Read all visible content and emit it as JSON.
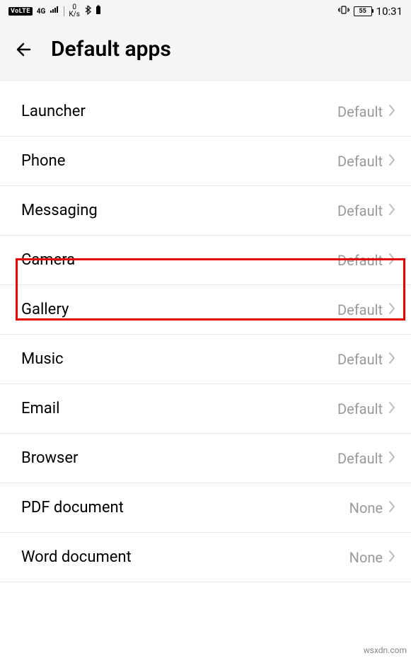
{
  "status_bar": {
    "volte": "VoLTE",
    "network": "4G",
    "speed_top": "0",
    "speed_bottom": "K/s",
    "battery": "55",
    "time": "10:31"
  },
  "header": {
    "title": "Default apps"
  },
  "settings": [
    {
      "label": "Launcher",
      "value": "Default",
      "key": "launcher"
    },
    {
      "label": "Phone",
      "value": "Default",
      "key": "phone"
    },
    {
      "label": "Messaging",
      "value": "Default",
      "key": "messaging"
    },
    {
      "label": "Camera",
      "value": "Default",
      "key": "camera",
      "highlighted": true
    },
    {
      "label": "Gallery",
      "value": "Default",
      "key": "gallery"
    },
    {
      "label": "Music",
      "value": "Default",
      "key": "music"
    },
    {
      "label": "Email",
      "value": "Default",
      "key": "email"
    },
    {
      "label": "Browser",
      "value": "Default",
      "key": "browser"
    },
    {
      "label": "PDF document",
      "value": "None",
      "key": "pdf-document"
    },
    {
      "label": "Word document",
      "value": "None",
      "key": "word-document"
    }
  ],
  "watermark": "wsxdn.com"
}
